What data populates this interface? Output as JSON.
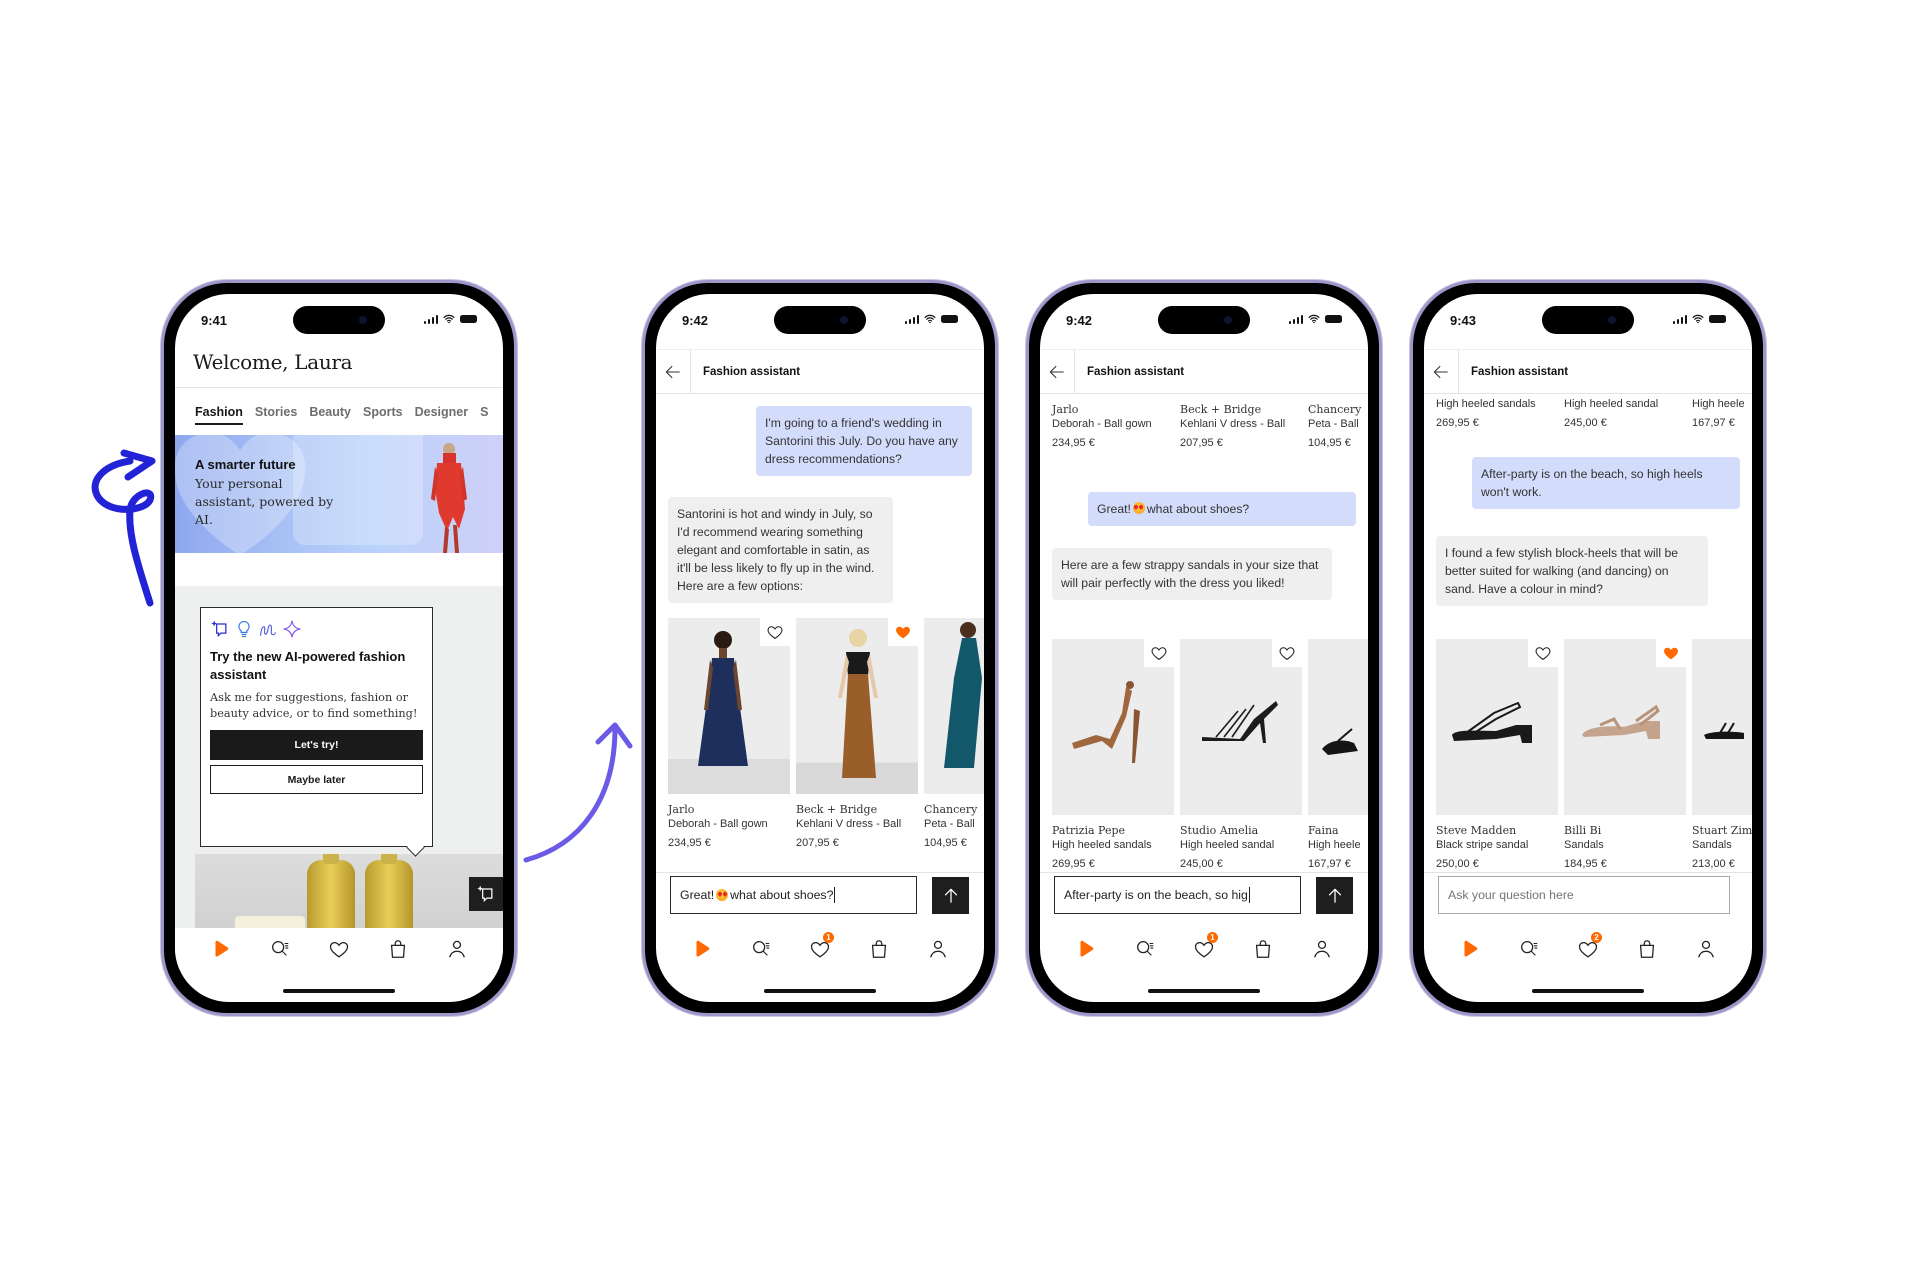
{
  "colors": {
    "accent": "#ff6900",
    "user_bubble": "#d4dcfb",
    "ai_bubble": "#efefef",
    "arrow_left": "#2222d6",
    "arrow_middle": "#6a5ae6",
    "phone_frame": "#9c97c9"
  },
  "phone1": {
    "status_time": "9:41",
    "welcome": "Welcome, Laura",
    "tabs": [
      "Fashion",
      "Stories",
      "Beauty",
      "Sports",
      "Designer",
      "S"
    ],
    "active_tab": "Fashion",
    "banner": {
      "title": "A smarter future",
      "subtitle": "Your personal assistant, powered by AI."
    },
    "ai_card": {
      "icons": [
        "sparkle-chat-icon",
        "lightbulb-icon",
        "squiggle-icon",
        "sparkle-icon"
      ],
      "title": "Try the new AI-powered fashion assistant",
      "description": "Ask me for suggestions, fashion or beauty advice, or to find something!",
      "primary_button": "Let's try!",
      "secondary_button": "Maybe later"
    },
    "nav": {
      "wishlist_badge": ""
    }
  },
  "phone2": {
    "status_time": "9:42",
    "header_title": "Fashion assistant",
    "messages": [
      {
        "role": "user",
        "text": "I'm going to a friend's wedding in Santorini this July. Do you have any dress recommendations?"
      },
      {
        "role": "assistant",
        "text": "Santorini is hot and windy in July, so I'd recommend wearing something elegant and comfortable in satin, as it'll be less likely to fly up in the wind. Here are a few options:"
      }
    ],
    "products": [
      {
        "brand": "Jarlo",
        "name": "Deborah - Ball gown",
        "price": "234,95 €",
        "favorited": false
      },
      {
        "brand": "Beck + Bridge",
        "name": "Kehlani V dress - Ball",
        "price": "207,95 €",
        "favorited": true
      },
      {
        "brand": "Chancery",
        "name": "Peta - Ball",
        "price": "104,95 €",
        "favorited": false
      }
    ],
    "input_value": "Great! 😍 what about shoes?",
    "input_text_before_emoji": "Great!",
    "input_text_after_emoji": "what about shoes?",
    "nav": {
      "wishlist_badge": "1"
    }
  },
  "phone3": {
    "status_time": "9:42",
    "header_title": "Fashion assistant",
    "prev_products": [
      {
        "brand": "Jarlo",
        "name": "Deborah - Ball gown",
        "price": "234,95 €"
      },
      {
        "brand": "Beck + Bridge",
        "name": "Kehlani V dress - Ball",
        "price": "207,95 €"
      },
      {
        "brand": "Chancery",
        "name": "Peta - Ball",
        "price": "104,95 €"
      }
    ],
    "messages": [
      {
        "role": "user",
        "text_before_emoji": "Great!",
        "text_after_emoji": "what about shoes?"
      },
      {
        "role": "assistant",
        "text": "Here are a few strappy sandals in your size that will pair perfectly with the dress you liked!"
      }
    ],
    "products": [
      {
        "brand": "Patrizia Pepe",
        "name": "High heeled sandals",
        "price": "269,95 €",
        "favorited": false
      },
      {
        "brand": "Studio Amelia",
        "name": "High heeled sandal",
        "price": "245,00 €",
        "favorited": false
      },
      {
        "brand": "Faina",
        "name": "High heele",
        "price": "167,97 €",
        "favorited": false
      }
    ],
    "input_value": "After-party is on the beach, so hig",
    "nav": {
      "wishlist_badge": "1"
    }
  },
  "phone4": {
    "status_time": "9:43",
    "header_title": "Fashion assistant",
    "prev_products": [
      {
        "name": "High heeled sandals",
        "price": "269,95 €"
      },
      {
        "name": "High heeled sandal",
        "price": "245,00 €"
      },
      {
        "name": "High heele",
        "price": "167,97 €"
      }
    ],
    "messages": [
      {
        "role": "user",
        "text": "After-party is on the beach, so high heels won't work."
      },
      {
        "role": "assistant",
        "text": "I found a few stylish block-heels that will be better suited for walking (and dancing) on sand. Have a colour in mind?"
      }
    ],
    "products": [
      {
        "brand": "Steve Madden",
        "name": "Black stripe sandal",
        "price": "250,00 €",
        "favorited": false
      },
      {
        "brand": "Billi Bi",
        "name": "Sandals",
        "price": "184,95 €",
        "favorited": true
      },
      {
        "brand": "Stuart Zim",
        "name": "Sandals",
        "price": "213,00 €",
        "favorited": false
      }
    ],
    "input_placeholder": "Ask your question here",
    "nav": {
      "wishlist_badge": "2"
    }
  }
}
